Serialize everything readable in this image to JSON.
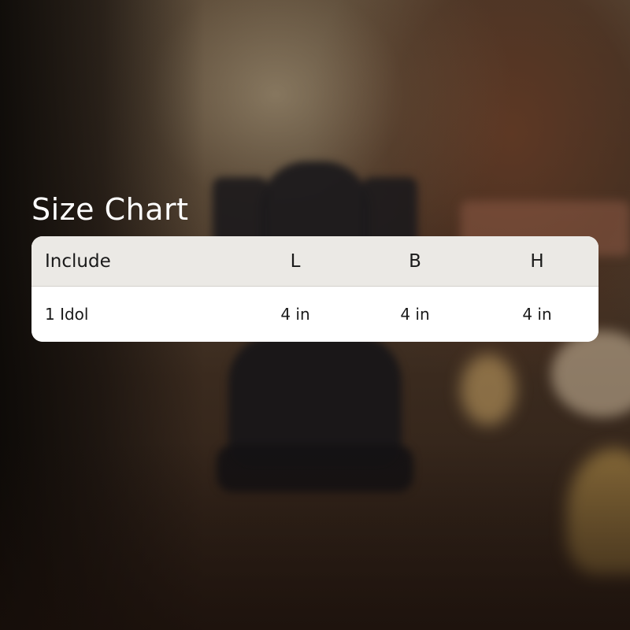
{
  "title": "Size Chart",
  "table": {
    "headers": [
      "Include",
      "L",
      "B",
      "H"
    ],
    "rows": [
      [
        "1 Idol",
        "4 in",
        "4 in",
        "4 in"
      ]
    ]
  },
  "colors": {
    "title_text": "#ffffff",
    "header_background": "#ebe9e5",
    "row_background": "#ffffff",
    "cell_text": "#1a1a1a"
  },
  "background_image": "blurred photo of dark stone Ganesha idol on wooden surface"
}
